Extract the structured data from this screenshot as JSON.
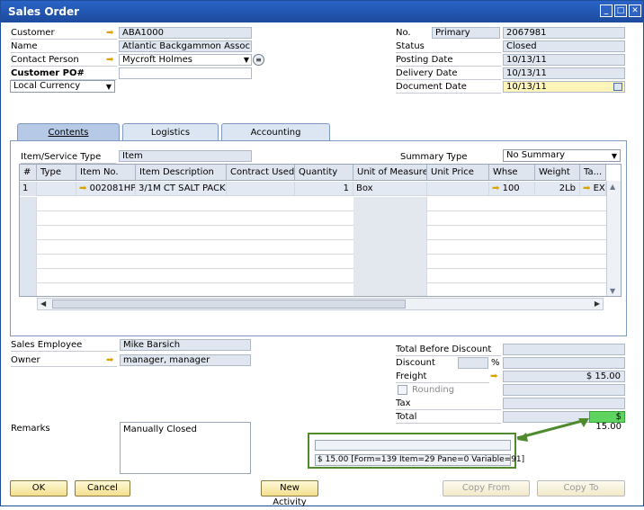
{
  "window": {
    "title": "Sales Order"
  },
  "header_left": {
    "customer_label": "Customer",
    "customer_value": "ABA1000",
    "name_label": "Name",
    "name_value": "Atlantic Backgammon Assoc.",
    "contact_label": "Contact Person",
    "contact_value": "Mycroft Holmes",
    "po_label": "Customer PO#",
    "po_value": "",
    "currency_value": "Local Currency"
  },
  "header_right": {
    "no_label": "No.",
    "series_value": "Primary",
    "no_value": "2067981",
    "status_label": "Status",
    "status_value": "Closed",
    "posting_label": "Posting Date",
    "posting_value": "10/13/11",
    "delivery_label": "Delivery Date",
    "delivery_value": "10/13/11",
    "document_label": "Document Date",
    "document_value": "10/13/11"
  },
  "tabs": [
    {
      "label": "Contents"
    },
    {
      "label": "Logistics"
    },
    {
      "label": "Accounting"
    }
  ],
  "contents": {
    "item_type_label": "Item/Service Type",
    "item_type_value": "Item",
    "summary_label": "Summary Type",
    "summary_value": "No Summary",
    "columns": [
      "#",
      "Type",
      "Item No.",
      "Item Description",
      "Contract Used",
      "Quantity",
      "Unit of Measure",
      "Unit Price",
      "Whse",
      "Weight",
      "Ta..."
    ],
    "rows": [
      {
        "num": "1",
        "type": "",
        "item_no": "002081HP",
        "desc": "3/1M CT SALT PACKE",
        "contract": "",
        "qty": "1",
        "uom": "Box",
        "price": "",
        "whse": "100",
        "weight": "2Lb",
        "tax": "EX"
      }
    ]
  },
  "footer_left": {
    "employee_label": "Sales Employee",
    "employee_value": "Mike Barsich",
    "owner_label": "Owner",
    "owner_value": "manager, manager",
    "remarks_label": "Remarks",
    "remarks_value": "Manually Closed"
  },
  "totals": {
    "before_discount_label": "Total Before Discount",
    "before_discount_value": "",
    "discount_label": "Discount",
    "discount_pct_symbol": "%",
    "freight_label": "Freight",
    "freight_value": "$ 15.00",
    "rounding_label": "Rounding",
    "tax_label": "Tax",
    "tax_value": "",
    "total_label": "Total",
    "total_value": "$ 15.00"
  },
  "tooltip": {
    "text": "$ 15.00 [Form=139 Item=29 Pane=0 Variable=91]"
  },
  "buttons": {
    "ok": "OK",
    "cancel": "Cancel",
    "new_activity": "New Activity",
    "copy_from": "Copy From",
    "copy_to": "Copy To"
  },
  "colors": {
    "title_bar": "#2a64c7",
    "highlight_total": "#5fd35f",
    "callout": "#4f8a2f",
    "button": "#f3df8d"
  }
}
